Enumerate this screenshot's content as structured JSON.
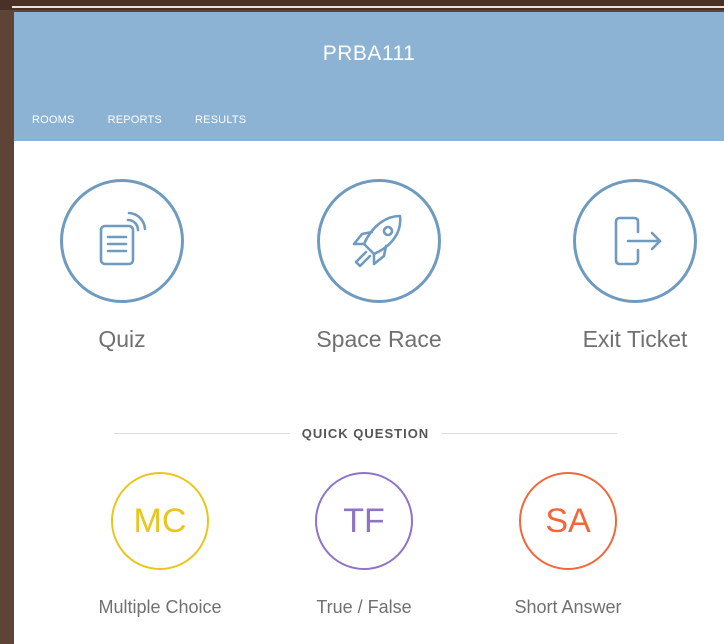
{
  "header": {
    "title": "PRBA111",
    "nav": [
      {
        "label": "ROOMS"
      },
      {
        "label": "REPORTS"
      },
      {
        "label": "RESULTS"
      }
    ],
    "background_color": "#8cb3d4"
  },
  "activities": [
    {
      "label": "Quiz",
      "icon": "quiz-tablet-icon"
    },
    {
      "label": "Space Race",
      "icon": "rocket-icon"
    },
    {
      "label": "Exit Ticket",
      "icon": "exit-door-icon"
    }
  ],
  "quick_question": {
    "heading": "QUICK QUESTION",
    "options": [
      {
        "abbr": "MC",
        "label": "Multiple Choice",
        "color": "#e8c61c"
      },
      {
        "abbr": "TF",
        "label": "True / False",
        "color": "#8e73c9"
      },
      {
        "abbr": "SA",
        "label": "Short Answer",
        "color": "#f2673a"
      }
    ]
  },
  "colors": {
    "activity_circle": "#6f9bc0",
    "text_muted": "#707070"
  }
}
